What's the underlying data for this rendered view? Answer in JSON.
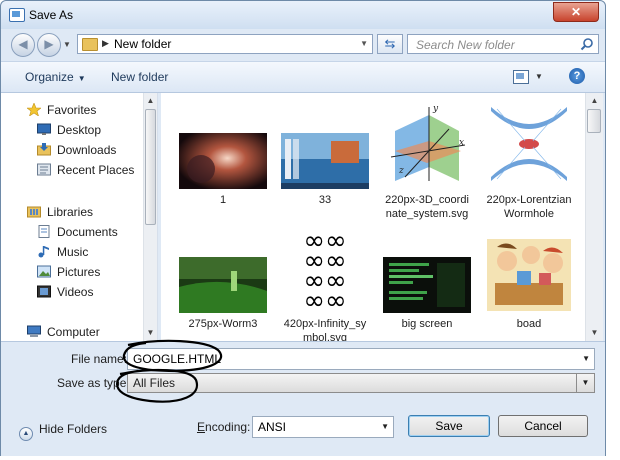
{
  "window": {
    "title": "Save As",
    "close_glyph": "✕"
  },
  "nav": {
    "back_glyph": "◀",
    "forward_glyph": "▶",
    "breadcrumb": "New folder",
    "search_placeholder": "Search New folder"
  },
  "toolbar": {
    "organize_label": "Organize",
    "new_folder_label": "New folder",
    "help_glyph": "?"
  },
  "sidebar": {
    "items": [
      {
        "label": "Favorites",
        "icon": "star-icon"
      },
      {
        "label": "Desktop",
        "icon": "desktop-icon"
      },
      {
        "label": "Downloads",
        "icon": "downloads-icon"
      },
      {
        "label": "Recent Places",
        "icon": "recent-places-icon"
      },
      {
        "label": "Libraries",
        "icon": "libraries-icon"
      },
      {
        "label": "Documents",
        "icon": "documents-icon"
      },
      {
        "label": "Music",
        "icon": "music-icon"
      },
      {
        "label": "Pictures",
        "icon": "pictures-icon"
      },
      {
        "label": "Videos",
        "icon": "videos-icon"
      },
      {
        "label": "Computer",
        "icon": "computer-icon"
      }
    ]
  },
  "files": [
    {
      "name": "1",
      "label_lines": [
        "1"
      ]
    },
    {
      "name": "33",
      "label_lines": [
        "33"
      ]
    },
    {
      "name": "220px-3D_coordinate_system.svg",
      "label_lines": [
        "220px-3D_coordi",
        "nate_system.svg"
      ]
    },
    {
      "name": "220px-LorentzianWormhole",
      "label_lines": [
        "220px-Lorentzian",
        "Wormhole"
      ]
    },
    {
      "name": "275px-Worm3",
      "label_lines": [
        "275px-Worm3"
      ]
    },
    {
      "name": "420px-Infinity_symbol.svg",
      "label_lines": [
        "420px-Infinity_sy",
        "mbol.svg"
      ]
    },
    {
      "name": "big screen",
      "label_lines": [
        "big screen"
      ]
    },
    {
      "name": "boad",
      "label_lines": [
        "boad"
      ]
    }
  ],
  "save_form": {
    "file_name_label": "File name:",
    "file_name_value": "GOOGLE.HTML",
    "save_as_type_label": "Save as type:",
    "save_as_type_value": "All Files",
    "encoding_label": "Encoding:",
    "encoding_value": "ANSI",
    "hide_folders_label": "Hide Folders",
    "save_label": "Save",
    "cancel_label": "Cancel"
  },
  "axes_labels": {
    "x": "x",
    "y": "y",
    "z": "z"
  }
}
